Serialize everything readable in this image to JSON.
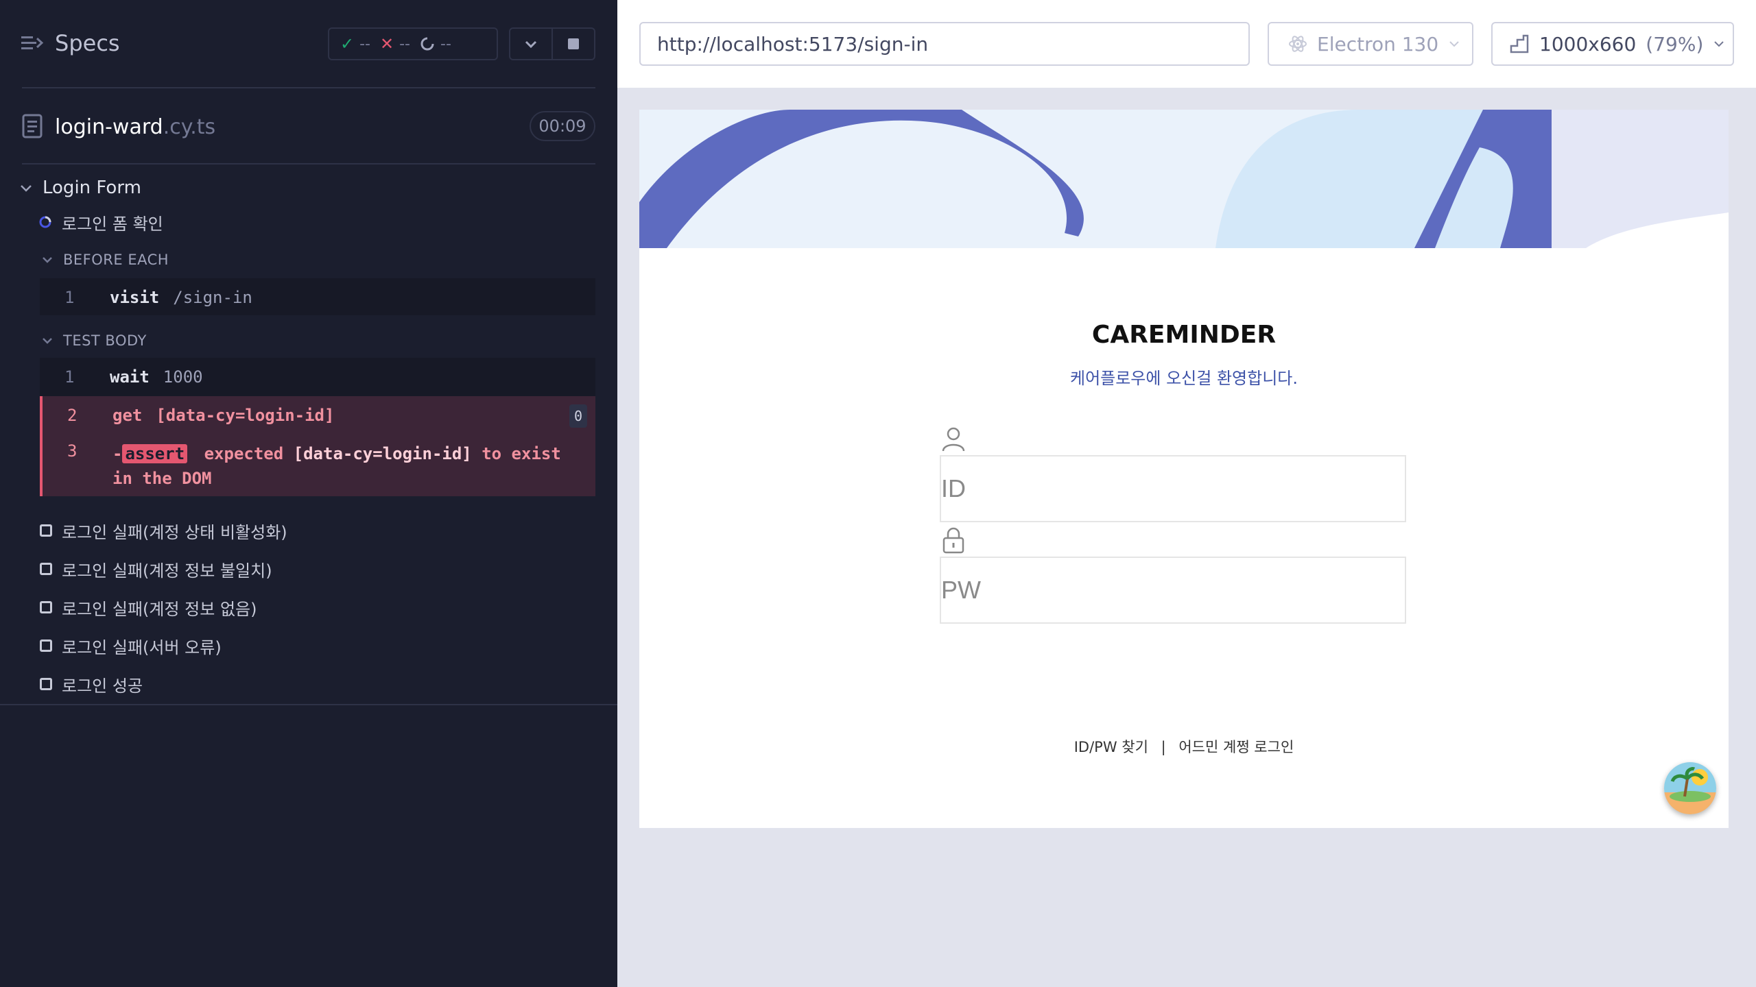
{
  "reporter": {
    "specs_label": "Specs",
    "stats": {
      "passed": "--",
      "failed": "--",
      "pending": "--"
    },
    "file": {
      "name": "login-ward",
      "ext": ".cy.ts",
      "duration": "00:09"
    },
    "suite": {
      "title": "Login Form"
    },
    "active_test": {
      "title": "로그인 폼 확인"
    },
    "hooks": {
      "before_each": {
        "label": "BEFORE EACH",
        "commands": [
          {
            "num": "1",
            "name": "visit",
            "message": "/sign-in"
          }
        ]
      },
      "test_body": {
        "label": "TEST BODY",
        "commands": [
          {
            "num": "1",
            "name": "wait",
            "message": "1000"
          },
          {
            "num": "2",
            "name": "get",
            "message": "[data-cy=login-id]",
            "badge": "0"
          },
          {
            "num": "3",
            "prefix": "-",
            "name": "assert",
            "pre": "expected",
            "subject": "[data-cy=login-id]",
            "post": "to exist",
            "tail": "in the DOM"
          }
        ]
      }
    },
    "pending_tests": [
      "로그인 실패(계정 상태 비활성화)",
      "로그인 실패(계정 정보 불일치)",
      "로그인 실패(계정 정보 없음)",
      "로그인 실패(서버 오류)",
      "로그인 성공"
    ]
  },
  "aut": {
    "url": "http://localhost:5173/sign-in",
    "browser": "Electron 130",
    "viewport": "1000x660",
    "scale": "(79%)",
    "page": {
      "title": "CAREMINDER",
      "welcome": "케어플로우에 오신걸 환영합니다.",
      "id_placeholder": "ID",
      "pw_placeholder": "PW",
      "link_find": "ID/PW 찾기",
      "link_sep": "|",
      "link_admin": "어드민 계쩡 로그인"
    }
  },
  "colors": {
    "reporter_bg": "#1b1e2e",
    "passed": "#1fa971",
    "failed": "#e45770",
    "accent": "#3d52a8",
    "banner_blue": "#5e6bc0"
  }
}
